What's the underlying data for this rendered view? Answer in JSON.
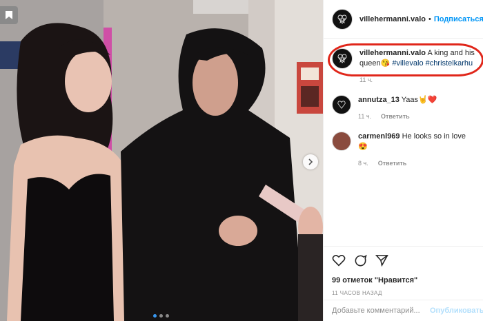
{
  "post": {
    "username": "villehermanni.valo",
    "follow_label": "Подписаться",
    "separator": "•"
  },
  "caption": {
    "username": "villehermanni.valo",
    "text": "A king and his queen",
    "emoji": "😘",
    "tag1": "#villevalo",
    "tag2": "#christelkarhu",
    "time": "11 ч."
  },
  "comments": [
    {
      "username": "annutza_13",
      "text": "Yaas🤘❤️",
      "time": "11 ч.",
      "reply_label": "Ответить"
    },
    {
      "username": "carmenl969",
      "text": "He looks so in love",
      "emoji": "😍",
      "time": "8 ч.",
      "reply_label": "Ответить"
    }
  ],
  "actions": {
    "likes": "99 отметок \"Нравится\"",
    "timestamp": "11 ЧАСОВ НАЗАД"
  },
  "add_comment": {
    "placeholder": "Добавьте комментарий...",
    "publish_label": "Опубликовать"
  },
  "colors": {
    "accent": "#0095f6",
    "highlight_ring": "#e0261a",
    "muted": "#8e8e8e"
  }
}
